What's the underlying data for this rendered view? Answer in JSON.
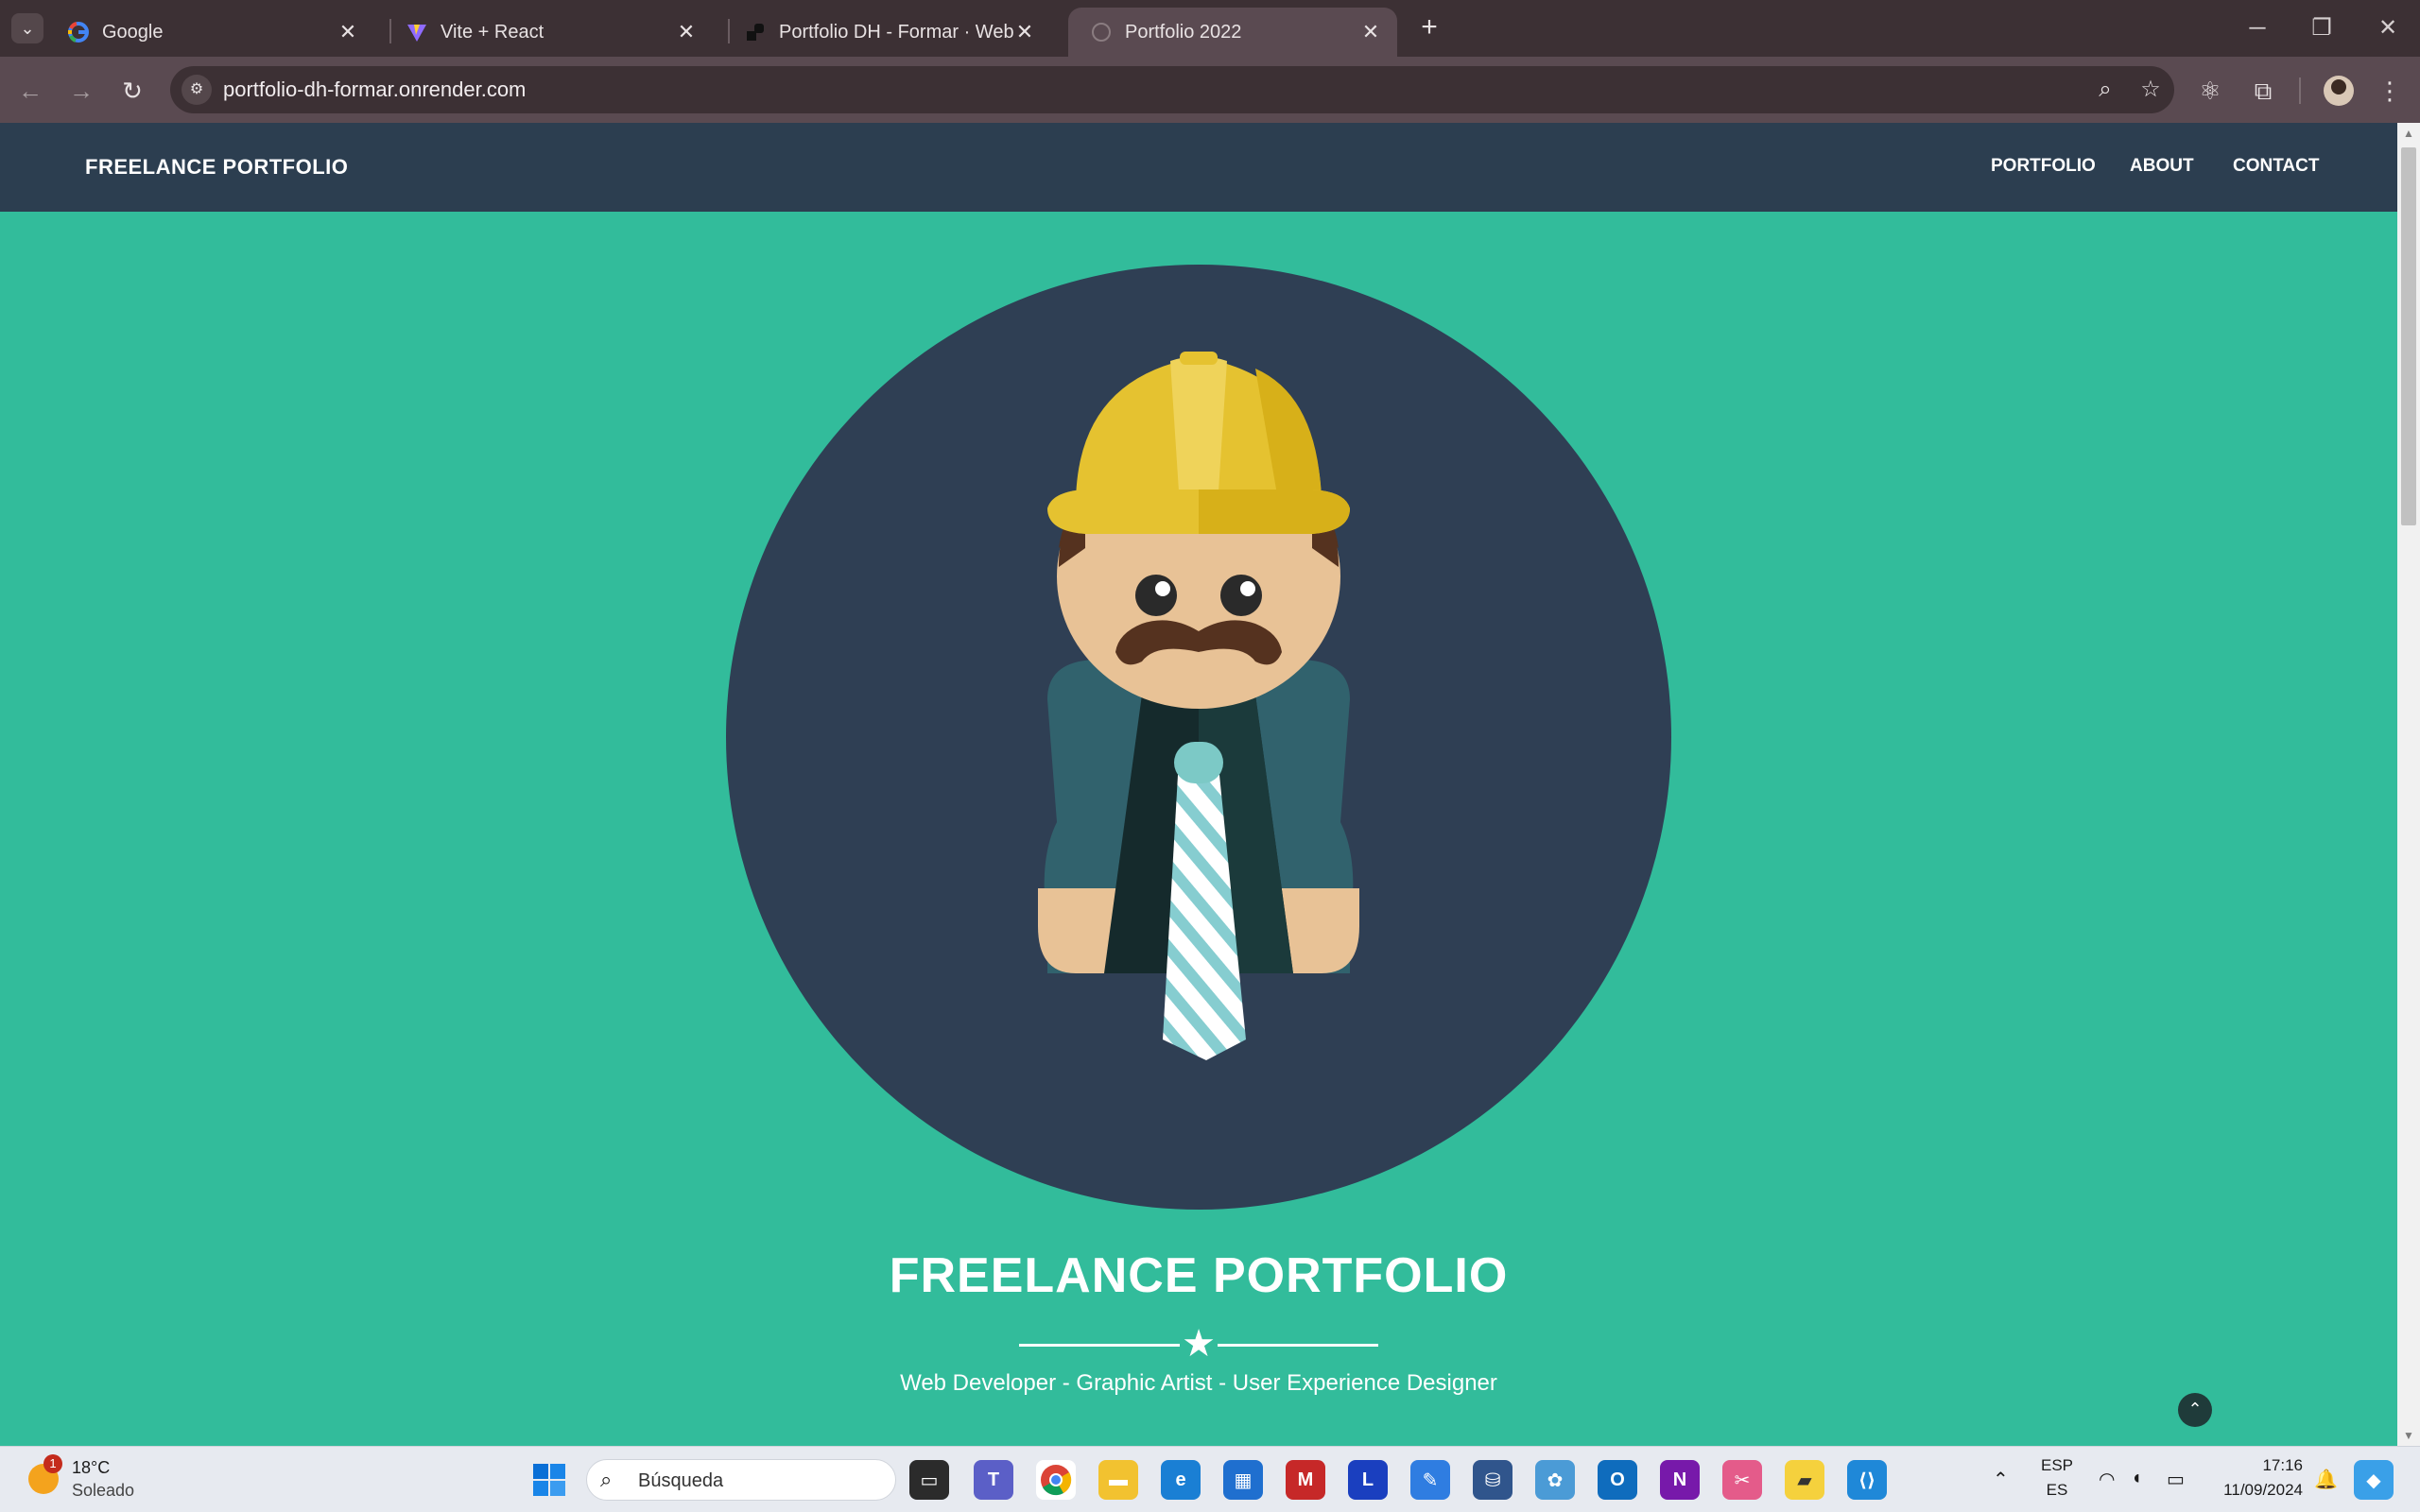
{
  "browser": {
    "tabs": [
      {
        "title": "Google",
        "active": false
      },
      {
        "title": "Vite + React",
        "active": false
      },
      {
        "title": "Portfolio DH - Formar · Web Se",
        "active": false
      },
      {
        "title": "Portfolio 2022",
        "active": true
      }
    ],
    "url": "portfolio-dh-formar.onrender.com",
    "colors": {
      "frame": "#3c3034",
      "toolbar": "#5a4a51"
    }
  },
  "site": {
    "brand": "FREELANCE PORTFOLIO",
    "nav": [
      "PORTFOLIO",
      "ABOUT",
      "CONTACT"
    ],
    "hero": {
      "title": "FREELANCE PORTFOLIO",
      "subtitle": "Web Developer - Graphic Artist - User Experience Designer"
    },
    "colors": {
      "nav_bg": "#2c3e50",
      "hero_bg": "#32bc9b",
      "circle": "#2f3f54"
    }
  },
  "taskbar": {
    "weather": {
      "badge": "1",
      "temp": "18°C",
      "condition": "Soleado"
    },
    "search_placeholder": "Búsqueda",
    "language": {
      "top": "ESP",
      "bottom": "ES"
    },
    "clock": {
      "time": "17:16",
      "date": "11/09/2024"
    }
  }
}
